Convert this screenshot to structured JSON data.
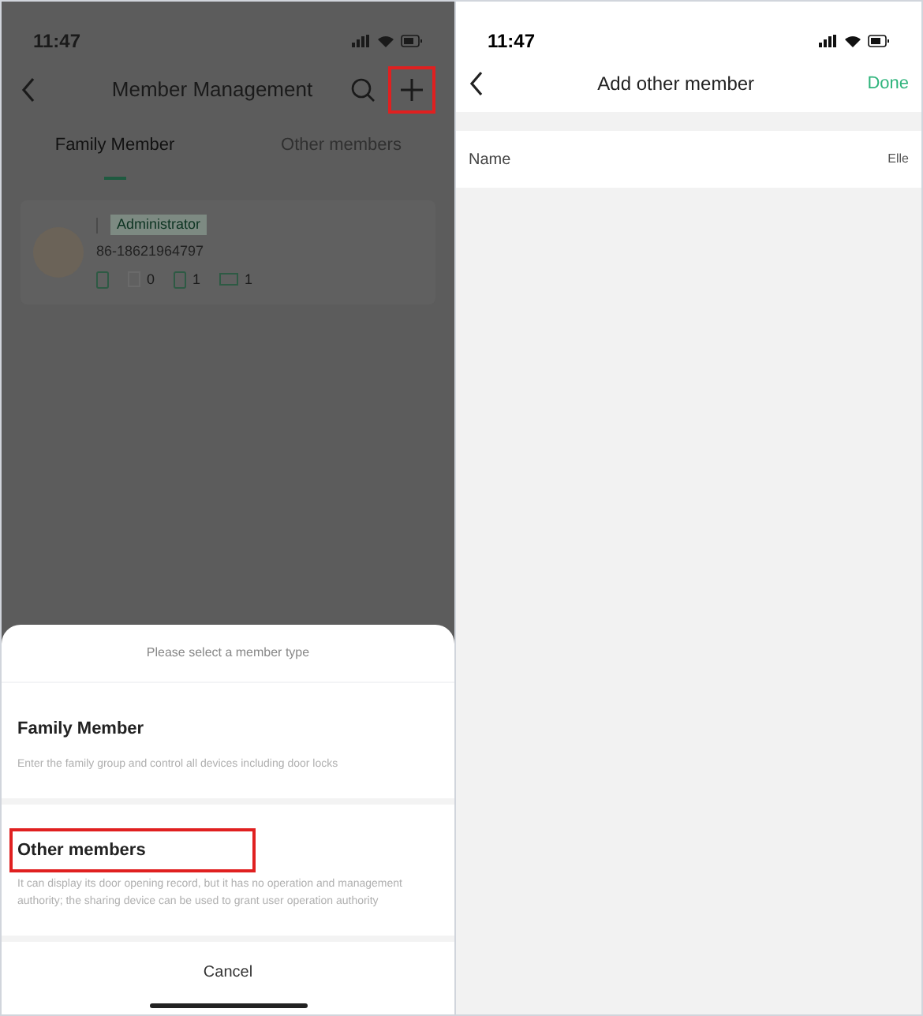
{
  "left_screen": {
    "status_bar": {
      "time": "11:47"
    },
    "header": {
      "title": "Member Management",
      "add_highlighted": true
    },
    "tabs": [
      {
        "label": "Family Member",
        "selected": true
      },
      {
        "label": "Other members",
        "selected": false
      }
    ],
    "member": {
      "role": "Administrator",
      "phone": "86-18621964797",
      "counts": [
        "0",
        "1",
        "1"
      ]
    },
    "sheet": {
      "title": "Please select a member type",
      "options": [
        {
          "title": "Family Member",
          "description": "Enter the family group and control all devices including door locks",
          "highlighted": false
        },
        {
          "title": "Other members",
          "description": "It can display its door opening record, but it has no operation and management authority; the sharing device can be used to grant user operation authority",
          "highlighted": true
        }
      ],
      "cancel": "Cancel"
    }
  },
  "right_screen": {
    "status_bar": {
      "time": "11:47"
    },
    "header": {
      "title": "Add other member",
      "action": "Done"
    },
    "fields": [
      {
        "label": "Name",
        "value": "Elle"
      }
    ]
  }
}
